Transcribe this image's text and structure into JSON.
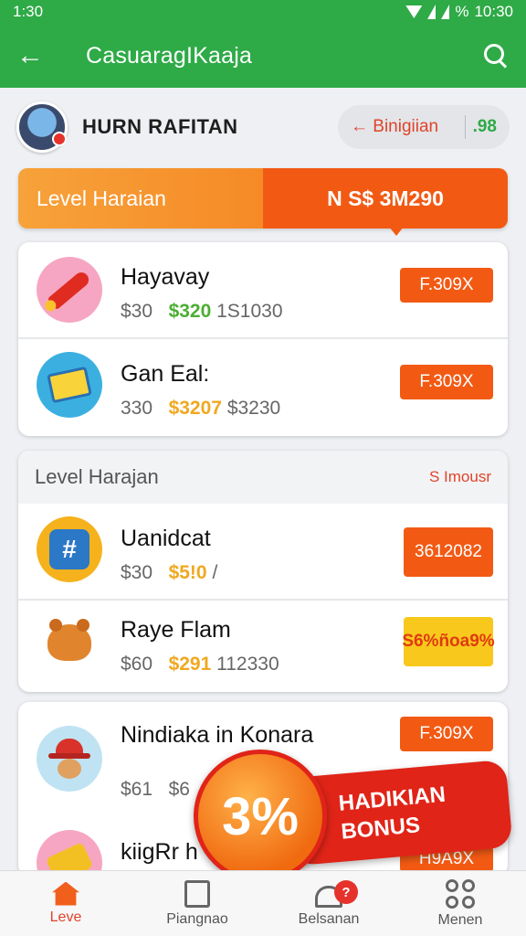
{
  "status_bar": {
    "left_time": "1:30",
    "battery": "%",
    "right_time": "10:30"
  },
  "app_bar": {
    "title": "CasuaragIKaaja"
  },
  "profile": {
    "name": "HURN RAFITAN",
    "pill_label": "Binigiian",
    "pill_value": ".98",
    "pill_arrow": "←"
  },
  "banner": {
    "left": "Level Haraian",
    "right": "N S$ 3M290"
  },
  "card1": {
    "rows": [
      {
        "name": "Hayavay",
        "price1": "$30",
        "price2": "$320",
        "price3": "1S1030",
        "tag": "F.309X"
      },
      {
        "name": "Gan Eal:",
        "price1": "330",
        "price2": "$3207",
        "price3": "$3230",
        "tag": "F.309X"
      }
    ]
  },
  "card2": {
    "header": "Level Harajan",
    "link": "Imousr",
    "link_icon": "S",
    "rows": [
      {
        "name": "Uanidcat",
        "price1": "$30",
        "price2": "$5!0",
        "price3": "/",
        "tag_line1": "36",
        "tag_line2": "12082"
      },
      {
        "name": "Raye Flam",
        "price1": "$60",
        "price2": "$291",
        "price3": "112330",
        "tag_line1": "S6%",
        "tag_line2": "ñoa9%"
      }
    ]
  },
  "card3": {
    "rows": [
      {
        "name": "Nindiaka in Konara",
        "price1": "$61",
        "price2": "$6",
        "tag": "F.309X"
      },
      {
        "name": "kiigRr h",
        "tag": "H9A9X"
      }
    ]
  },
  "bonus": {
    "percent": "3%",
    "line1": "HADIKIAN",
    "line2": "BONUS"
  },
  "nav": [
    {
      "label": "Leve",
      "icon": "home-icon"
    },
    {
      "label": "Piangnao",
      "icon": "document-icon"
    },
    {
      "label": "Belsanan",
      "icon": "bell-icon",
      "badge": "?"
    },
    {
      "label": "Menen",
      "icon": "grid-icon"
    }
  ],
  "colors": {
    "primary_green": "#2eaa47",
    "accent_orange": "#f25a14",
    "bonus_red": "#e02418"
  }
}
